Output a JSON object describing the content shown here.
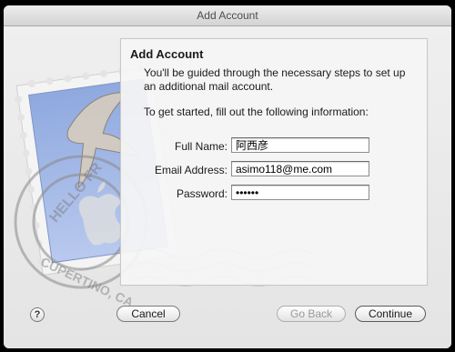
{
  "window": {
    "title": "Add Account"
  },
  "panel": {
    "heading": "Add Account",
    "intro": "You'll be guided through the necessary steps to set up an additional mail account.",
    "instruction": "To get started, fill out the following information:"
  },
  "form": {
    "full_name": {
      "label": "Full Name:",
      "value": "阿西彦"
    },
    "email": {
      "label": "Email Address:",
      "value": "asimo118@me.com"
    },
    "password": {
      "label": "Password:",
      "value": "••••••"
    }
  },
  "buttons": {
    "help": "?",
    "cancel": "Cancel",
    "back": "Go Back",
    "continue": "Continue"
  },
  "stamp": {
    "postmark_top": "HELLO FR",
    "postmark_bottom": "CUPERTINO, CA"
  },
  "icons": [
    "help-icon",
    "mail-stamp-icon",
    "eagle-icon",
    "apple-logo-icon"
  ]
}
